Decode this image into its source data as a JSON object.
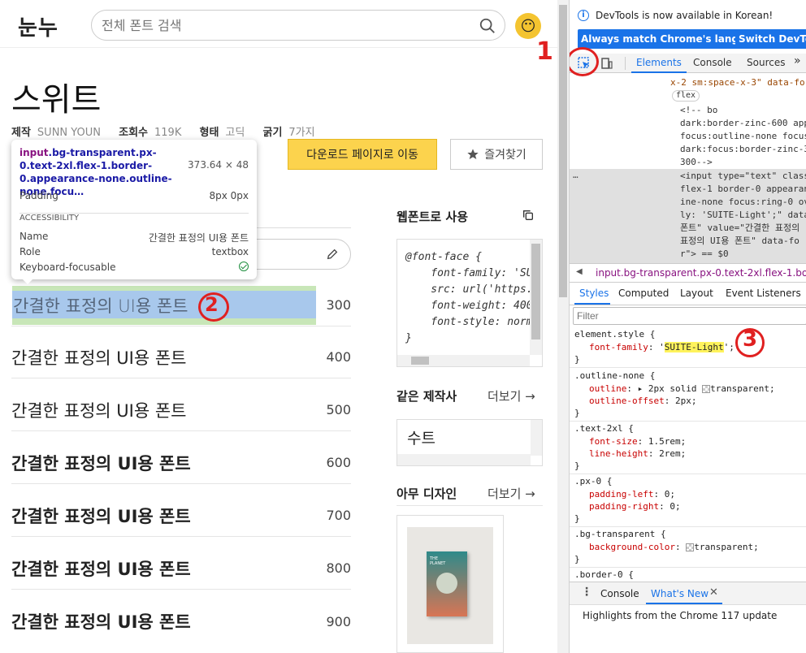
{
  "site": {
    "logo": "눈누",
    "search_placeholder": "전체 폰트 검색",
    "avatar_emoji": "😶"
  },
  "font": {
    "title": "스위트",
    "meta": [
      {
        "label": "제작",
        "value": "SUNN YOUN"
      },
      {
        "label": "조회수",
        "value": "119K"
      },
      {
        "label": "형태",
        "value": "고딕"
      },
      {
        "label": "굵기",
        "value": "7가지"
      }
    ],
    "download_label": "다운로드 페이지로 이동",
    "favorite_label": "즐겨찾기"
  },
  "tooltip": {
    "selector_tag": "input",
    "selector_classes": ".bg-transparent.px-0.text-2xl.flex-1.border-0.appearance-none.outline-none.focu…",
    "dimensions": "373.64 × 48",
    "padding_label": "Padding",
    "padding_value": "8px 0px",
    "accessibility_heading": "ACCESSIBILITY",
    "name_label": "Name",
    "name_value": "간결한 표정의 UI용 폰트",
    "role_label": "Role",
    "role_value": "textbox",
    "keyboard_label": "Keyboard-focusable"
  },
  "samples": [
    {
      "text": "간결한 표정의 UI용 폰트",
      "weight": "300"
    },
    {
      "text": "간결한 표정의 UI용 폰트",
      "weight": "400"
    },
    {
      "text": "간결한 표정의 UI용 폰트",
      "weight": "500"
    },
    {
      "text": "간결한 표정의 UI용 폰트",
      "weight": "600"
    },
    {
      "text": "간결한 표정의 UI용 폰트",
      "weight": "700"
    },
    {
      "text": "간결한 표정의 UI용 폰트",
      "weight": "800"
    },
    {
      "text": "간결한 표정의 UI용 폰트",
      "weight": "900"
    }
  ],
  "webfont": {
    "title": "웹폰트로 사용",
    "code": "@font-face {\n    font-family: 'SU\n    src: url('https.\n    font-weight: 400\n    font-style: norm\n}"
  },
  "same_maker": {
    "title": "같은 제작사",
    "more": "더보기 →",
    "item": "수트"
  },
  "any_design": {
    "title": "아무 디자인",
    "more": "더보기 →",
    "book_text": "THE PLANET"
  },
  "annotations": [
    "1",
    "2",
    "3"
  ],
  "devtools": {
    "notice": "DevTools is now available in Korean!",
    "btn_match": "Always match Chrome's language",
    "btn_switch": "Switch DevTools",
    "tabs": [
      "Elements",
      "Console",
      "Sources"
    ],
    "more_tabs": "»",
    "dom_lines": [
      "x-2 sm:space-x-3\" data-fo",
      "flex",
      "<!--              bo",
      "dark:border-zinc-600 app",
      "focus:outline-none focus",
      "dark:focus:border-zinc-3",
      "300-->",
      "<input type=\"text\" class",
      "flex-1 border-0 appearan",
      "ine-none focus:ring-0 ov",
      "ly: 'SUITE-Light';\" data",
      "폰트\" value=\"간결한 표정의",
      "표정의 UI용 폰트\" data-fo",
      "r\"> == $0"
    ],
    "ellipsis": "…",
    "breadcrumb": "input.bg-transparent.px-0.text-2xl.flex-1.border-0",
    "subtabs": [
      "Styles",
      "Computed",
      "Layout",
      "Event Listeners"
    ],
    "filter_placeholder": "Filter",
    "rules": {
      "element_style": "element.style {",
      "ff_prop": "font-family",
      "ff_val": "SUITE-Light",
      "outline_sel": ".outline-none {",
      "outline_prop": "outline",
      "outline_val": "2px solid",
      "outline_val2": "transparent;",
      "offset_prop": "outline-offset",
      "offset_val": "2px;",
      "text_sel": ".text-2xl {",
      "fs_prop": "font-size",
      "fs_val": "1.5rem;",
      "lh_prop": "line-height",
      "lh_val": "2rem;",
      "px_sel": ".px-0 {",
      "pl_prop": "padding-left",
      "pl_val": "0;",
      "pr_prop": "padding-right",
      "pr_val": "0;",
      "bg_sel": ".bg-transparent {",
      "bg_prop": "background-color",
      "bg_val": "transparent;",
      "border_sel": ".border-0 {",
      "close": "}"
    },
    "drawer_tabs": [
      "Console",
      "What's New"
    ],
    "drawer_text": "Highlights from the Chrome 117 update"
  }
}
